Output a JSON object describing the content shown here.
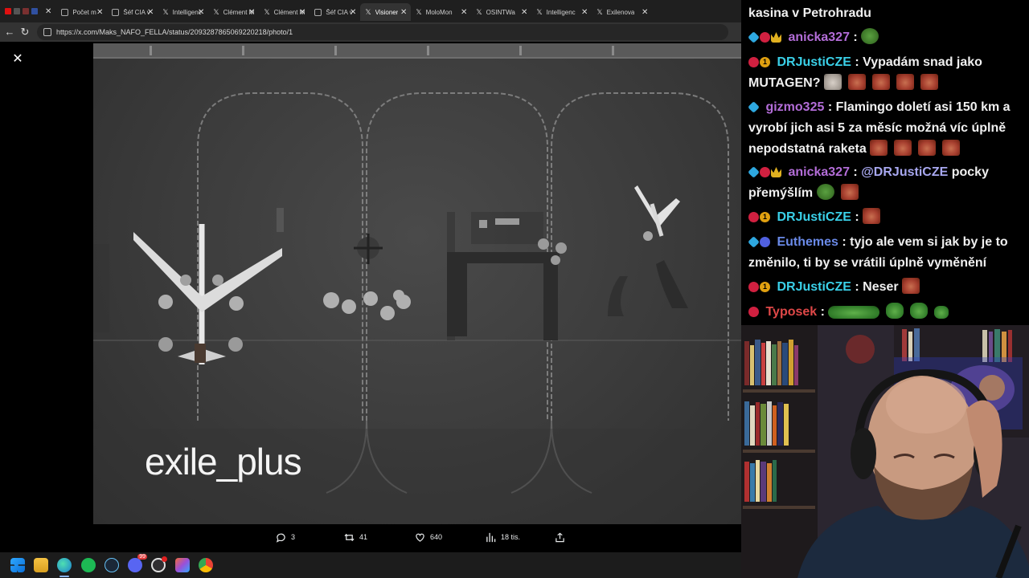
{
  "browser": {
    "tabs": [
      {
        "label": "Počet m",
        "icon": "video-icon"
      },
      {
        "label": "Šéf CIA v",
        "icon": "page-icon"
      },
      {
        "label": "Intelligenc",
        "icon": "x-logo-icon"
      },
      {
        "label": "Clément M",
        "icon": "x-logo-icon"
      },
      {
        "label": "Clément M",
        "icon": "x-logo-icon"
      },
      {
        "label": "Šéf CIA v",
        "icon": "page-icon"
      },
      {
        "label": "Visioner",
        "icon": "x-logo-icon"
      },
      {
        "label": "MoloMon",
        "icon": "x-logo-icon"
      },
      {
        "label": "OSINTWa",
        "icon": "x-logo-icon"
      },
      {
        "label": "Intelligenc",
        "icon": "x-logo-icon"
      },
      {
        "label": "Exilenova",
        "icon": "x-logo-icon"
      }
    ],
    "active_tab": 6,
    "url": "https://x.com/Maks_NAFO_FELLA/status/2093287865069220218/photo/1"
  },
  "viewer": {
    "watermark": "exile_plus",
    "stats": {
      "replies": "3",
      "reposts": "41",
      "likes": "640",
      "views": "18 tis."
    }
  },
  "chat": {
    "messages": [
      {
        "user": "",
        "text": "kasina v Petrohradu",
        "badges": [],
        "user_color": "#ffffff"
      },
      {
        "user": "anicka327",
        "text": ":",
        "badges": [
          "cube",
          "gem",
          "crown"
        ],
        "user_color": "#b36dd8",
        "emotes": [
          "frog"
        ]
      },
      {
        "user": "DRJustiCZE",
        "text": ": Vypadám snad jako MUTAGEN?",
        "badges": [
          "gem",
          "one"
        ],
        "user_color": "#3ad0e8",
        "emotes": [
          "cat",
          "face",
          "face",
          "face",
          "face"
        ]
      },
      {
        "user": "gizmo325",
        "text": ": Flamingo doletí asi 150 km a vyrobí jich asi 5 za měsíc možná víc úplně nepodstatná raketa",
        "badges": [
          "cube"
        ],
        "user_color": "#b36dd8",
        "emotes": [
          "face",
          "face",
          "face",
          "face"
        ]
      },
      {
        "user": "anicka327",
        "text": ":",
        "mention": "@DRJustiCZE",
        "after": "pocky přemýšlím",
        "badges": [
          "cube",
          "gem",
          "crown"
        ],
        "user_color": "#b36dd8",
        "emotes": [
          "frog",
          "face"
        ]
      },
      {
        "user": "DRJustiCZE",
        "text": ":",
        "badges": [
          "gem",
          "one"
        ],
        "user_color": "#3ad0e8",
        "emotes": [
          "face"
        ]
      },
      {
        "user": "Euthemes",
        "text": ": tyjo ale vem si jak by je to změnilo, ti by se vrátili úplně vyměnění",
        "badges": [
          "cube",
          "blue"
        ],
        "user_color": "#6a8ae8"
      },
      {
        "user": "DRJustiCZE",
        "text": ": Neser",
        "badges": [
          "gem",
          "one"
        ],
        "user_color": "#3ad0e8",
        "emotes": [
          "face"
        ]
      },
      {
        "user": "Typosek",
        "text": ":",
        "badges": [
          "gem"
        ],
        "user_color": "#e04848",
        "emotes": [
          "pepe-wide",
          "pepe",
          "pepe",
          "pepe"
        ]
      }
    ]
  },
  "taskbar": {
    "apps": [
      "windows-start-icon",
      "file-explorer-icon",
      "edge-browser-icon",
      "spotify-icon",
      "steam-icon",
      "discord-icon",
      "obs-icon",
      "photo-app-icon",
      "chrome-icon"
    ],
    "discord_badge": "99"
  },
  "colors": {
    "chat_bg": "#000000",
    "tab_bar": "#1f1f1f",
    "address_bar": "#333333"
  }
}
